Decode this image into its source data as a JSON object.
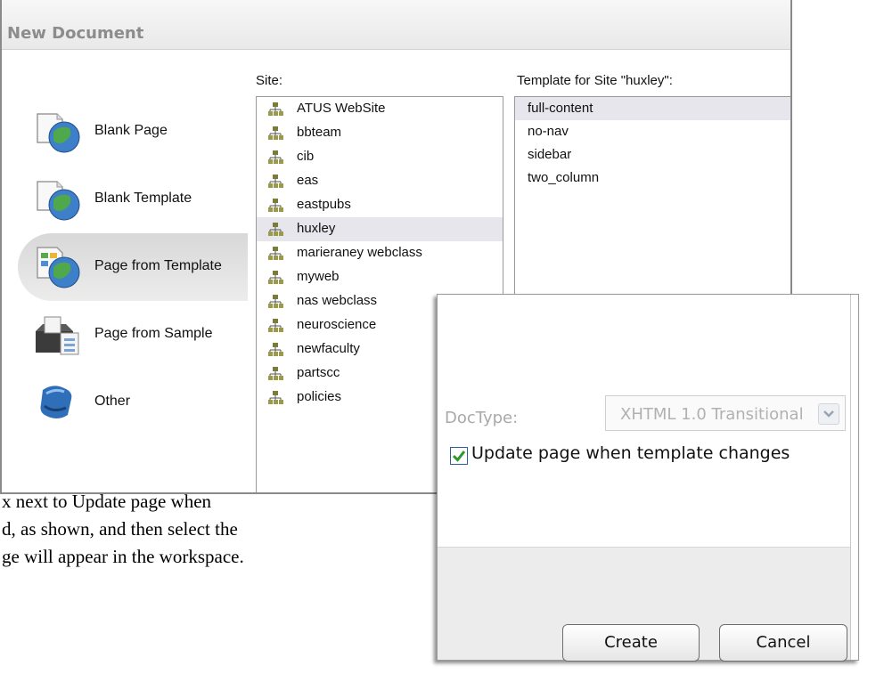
{
  "dialog": {
    "title": "New Document",
    "categories": [
      {
        "label": "Blank Page",
        "icon": "blank-page-icon"
      },
      {
        "label": "Blank Template",
        "icon": "blank-template-icon"
      },
      {
        "label": "Page from Template",
        "icon": "page-from-template-icon",
        "selected": true
      },
      {
        "label": "Page from Sample",
        "icon": "page-from-sample-icon"
      },
      {
        "label": "Other",
        "icon": "other-icon"
      }
    ],
    "site_label": "Site:",
    "sites": [
      {
        "label": "ATUS WebSite"
      },
      {
        "label": "bbteam"
      },
      {
        "label": "cib"
      },
      {
        "label": "eas"
      },
      {
        "label": "eastpubs"
      },
      {
        "label": "huxley",
        "selected": true
      },
      {
        "label": "marieraney webclass"
      },
      {
        "label": "myweb"
      },
      {
        "label": "nas webclass"
      },
      {
        "label": "neuroscience"
      },
      {
        "label": "newfaculty"
      },
      {
        "label": "partscc"
      },
      {
        "label": "policies"
      }
    ],
    "template_label": "Template for Site \"huxley\":",
    "templates": [
      {
        "label": "full-content",
        "selected": true
      },
      {
        "label": "no-nav"
      },
      {
        "label": "sidebar"
      },
      {
        "label": "two_column"
      }
    ]
  },
  "overlay": {
    "doctype_label": "DocType:",
    "doctype_value": "XHTML 1.0 Transitional",
    "update_checkbox_label": "Update page when template changes",
    "update_checked": true,
    "create_label": "Create",
    "cancel_label": "Cancel"
  },
  "doc_text": {
    "line1": "x next to Update page when",
    "line2": "d, as shown, and then select the",
    "line3": "ge will appear in the workspace."
  },
  "colors": {
    "selection": "#e6e6ec",
    "title_text": "#8c8c8c",
    "checkmark": "#2b9a2b"
  }
}
